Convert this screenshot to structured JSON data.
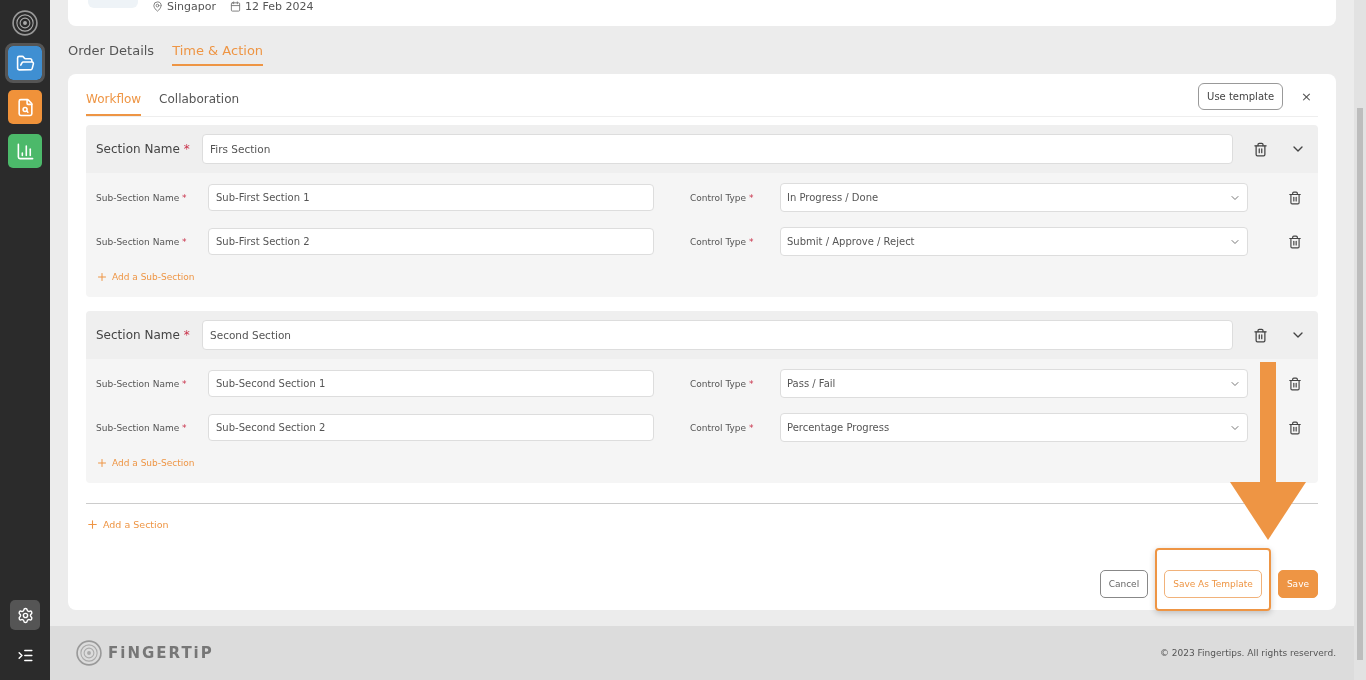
{
  "sidebar": {
    "items": [
      {
        "color": "#3f8fd2",
        "selected": true
      },
      {
        "color": "#f0923a",
        "selected": false
      },
      {
        "color": "#4cb96a",
        "selected": false
      }
    ],
    "bottom_items": [
      {
        "selected": true
      },
      {
        "selected": false
      }
    ]
  },
  "order_summary": {
    "location": "Singapor",
    "date": "12 Feb 2024"
  },
  "tabs": [
    {
      "label": "Order Details",
      "selected": false
    },
    {
      "label": "Time & Action",
      "selected": true
    }
  ],
  "panel": {
    "tabs": [
      {
        "label": "Workflow",
        "selected": true
      },
      {
        "label": "Collaboration",
        "selected": false
      }
    ],
    "use_template": "Use template",
    "close": "×",
    "sections": [
      {
        "label": "Section Name",
        "mark": "*",
        "value": "Firs Section",
        "expanded": true,
        "subsections": [
          {
            "name_label": "Sub-Section Name",
            "name_mark": "*",
            "name": "Sub-First Section 1",
            "type_label": "Control Type",
            "type_mark": "*",
            "control_type": "In Progress / Done"
          },
          {
            "name_label": "Sub-Section Name",
            "name_mark": "*",
            "name": "Sub-First Section 2",
            "type_label": "Control Type",
            "type_mark": "*",
            "control_type": "Submit / Approve / Reject"
          }
        ],
        "add_sub": "Add a Sub-Section"
      },
      {
        "label": "Section Name",
        "mark": "*",
        "value": "Second Section",
        "expanded": true,
        "subsections": [
          {
            "name_label": "Sub-Section Name",
            "name_mark": "*",
            "name": "Sub-Second Section 1",
            "type_label": "Control Type",
            "type_mark": "*",
            "control_type": "Pass / Fail"
          },
          {
            "name_label": "Sub-Section Name",
            "name_mark": "*",
            "name": "Sub-Second Section 2",
            "type_label": "Control Type",
            "type_mark": "*",
            "control_type": "Percentage Progress"
          }
        ],
        "add_sub": "Add a Sub-Section"
      }
    ],
    "add_section": "Add a Section",
    "buttons": [
      {
        "kind": "outline",
        "label": "Cancel",
        "highlighted": false
      },
      {
        "kind": "accent-outline",
        "label": "Save As Template",
        "highlighted": true
      },
      {
        "kind": "primary",
        "label": "Save",
        "highlighted": false
      }
    ]
  },
  "footer": {
    "brand": "FiNGERTiP",
    "copyright": "© 2023 Fingertips. All rights reserverd."
  }
}
